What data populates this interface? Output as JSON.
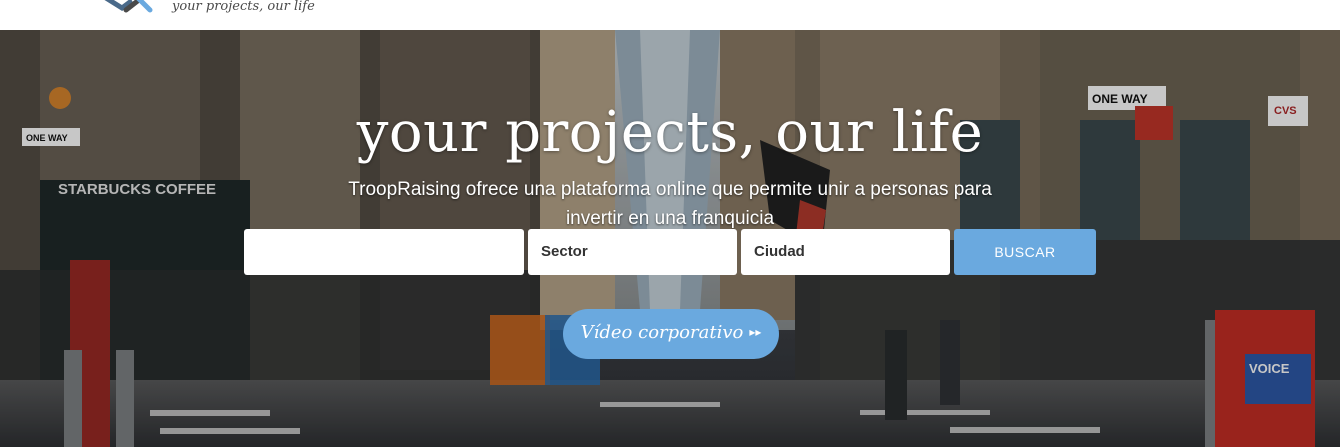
{
  "header": {
    "tagline": "your projects, our life"
  },
  "hero": {
    "headline": "your projects, our life",
    "description": "TroopRaising ofrece una plataforma online que permite unir a personas para invertir en una franquicia"
  },
  "search": {
    "keyword_value": "",
    "sector_value": "Sector",
    "city_value": "Ciudad",
    "button_label": "BUSCAR"
  },
  "video": {
    "label": "Vídeo corporativo",
    "icon": "fast-forward-icon",
    "icon_glyph": "▸▸"
  },
  "colors": {
    "accent": "#6aa9df"
  }
}
